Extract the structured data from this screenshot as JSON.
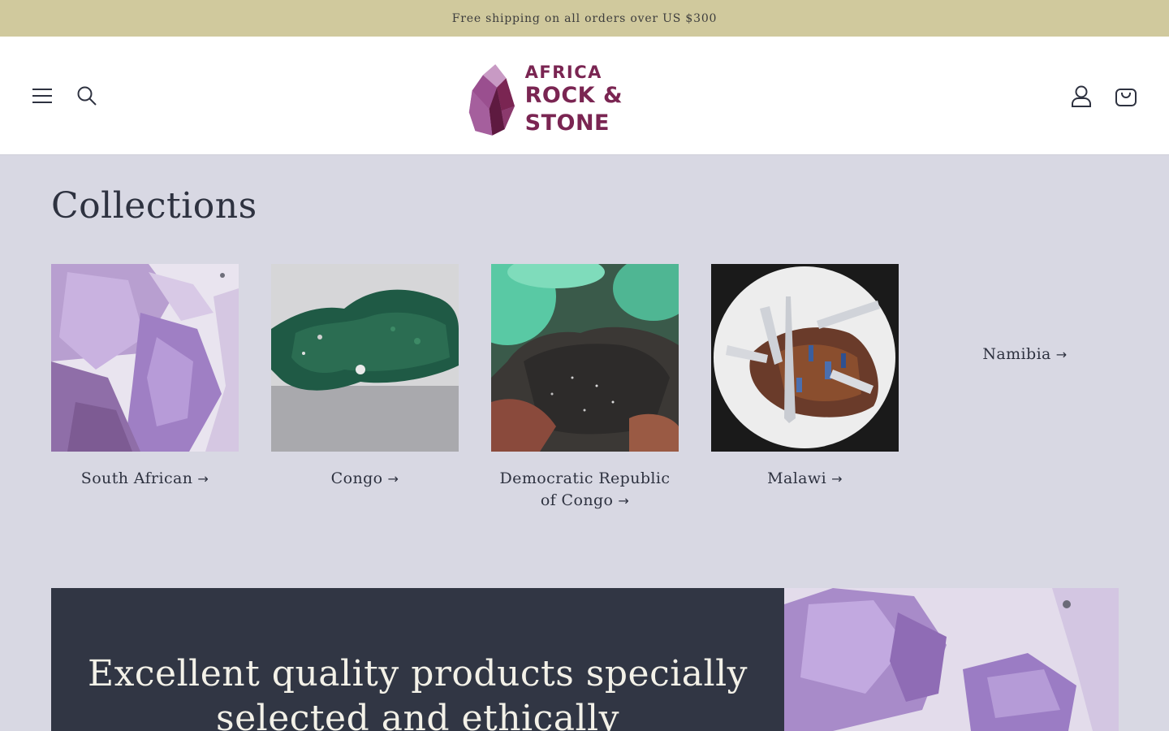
{
  "announcement": {
    "text": "Free shipping on all orders over US $300"
  },
  "header": {
    "logo": {
      "line1": "AFRICA",
      "line2": "ROCK & STONE"
    },
    "icons": {
      "menu": "hamburger-icon",
      "search": "search-icon",
      "account": "user-icon",
      "cart": "bag-icon"
    }
  },
  "collections": {
    "title": "Collections",
    "items": [
      {
        "label": "South African",
        "image": "amethyst-crystal"
      },
      {
        "label": "Congo",
        "image": "green-malachite"
      },
      {
        "label": "Democratic Republic of Congo",
        "image": "druzy-mineral"
      },
      {
        "label": "Malawi",
        "image": "quartz-cluster"
      },
      {
        "label": "Namibia",
        "image": ""
      }
    ],
    "arrow": "→"
  },
  "banner": {
    "heading": "Excellent quality products specially selected and ethically"
  },
  "colors": {
    "announcement_bg": "#d0c99d",
    "page_bg": "#d8d8e3",
    "banner_bg": "#313644",
    "brand": "#7a2552"
  }
}
